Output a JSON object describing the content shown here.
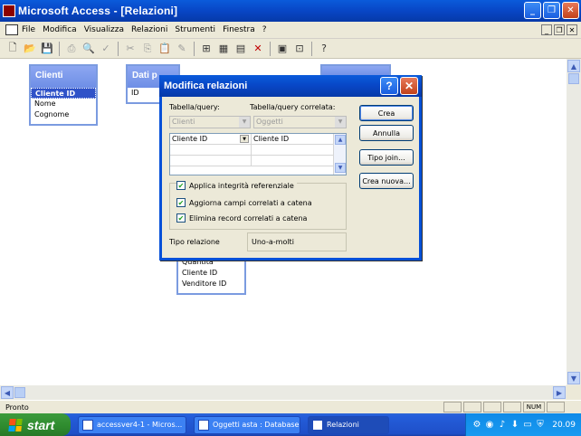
{
  "window": {
    "title": "Microsoft Access - [Relazioni]"
  },
  "menubar": {
    "items": [
      "File",
      "Modifica",
      "Visualizza",
      "Relazioni",
      "Strumenti",
      "Finestra",
      "?"
    ]
  },
  "tables": {
    "clienti": {
      "title": "Clienti",
      "fields": [
        "Cliente ID",
        "Nome",
        "Cognome"
      ]
    },
    "dati": {
      "title": "Dati p",
      "fields": [
        "ID"
      ]
    },
    "oggetti": {
      "fields": [
        "Quantità",
        "Cliente ID",
        "Venditore ID"
      ]
    }
  },
  "dialog": {
    "title": "Modifica relazioni",
    "table_label": "Tabella/query:",
    "related_label": "Tabella/query correlata:",
    "table_value": "Clienti",
    "related_value": "Oggetti",
    "grid": [
      {
        "left": "Cliente  ID",
        "right": "Cliente ID"
      },
      {
        "left": "",
        "right": ""
      },
      {
        "left": "",
        "right": ""
      }
    ],
    "enforce_label": "Applica integrità referenziale",
    "cascade_update_label": "Aggiorna campi correlati a catena",
    "cascade_delete_label": "Elimina record correlati a catena",
    "relation_type_label": "Tipo relazione",
    "relation_type_value": "Uno-a-molti",
    "buttons": {
      "create": "Crea",
      "cancel": "Annulla",
      "join": "Tipo join...",
      "new": "Crea nuova..."
    },
    "help_glyph": "?",
    "close_glyph": "✕"
  },
  "statusbar": {
    "text": "Pronto",
    "num": "NUM"
  },
  "taskbar": {
    "start": "start",
    "tasks": [
      "accessver4-1 - Micros...",
      "Oggetti asta : Database",
      "Relazioni"
    ],
    "clock": "20.09"
  }
}
